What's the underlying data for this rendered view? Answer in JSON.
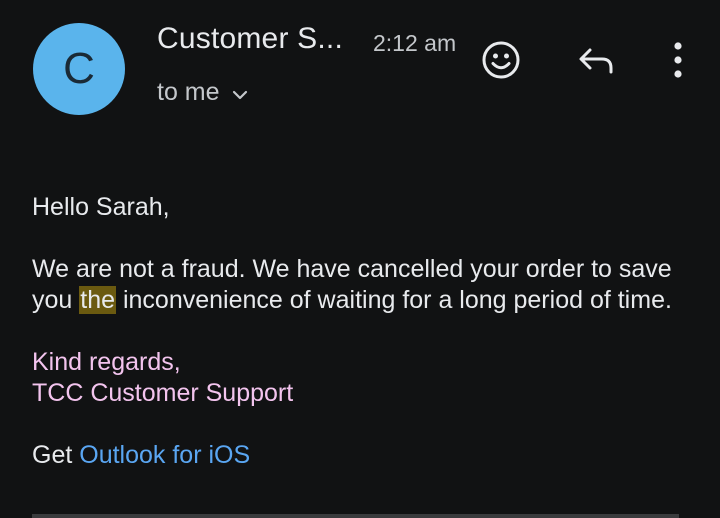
{
  "header": {
    "avatar_letter": "C",
    "sender": "Customer S...",
    "time": "2:12 am",
    "recipients": "to me"
  },
  "icons": {
    "avatar": "avatar",
    "emoji": "emoji-reaction-icon",
    "reply": "reply-icon",
    "more": "more-vertical-icon",
    "details": "chevron-down-icon"
  },
  "body": {
    "greeting": "Hello Sarah,",
    "paragraph_before": "We are not a fraud. We have cancelled your order to save you ",
    "highlight": "the",
    "paragraph_after": " inconvenience of waiting for a long period of time.",
    "sign_off": "Kind regards,",
    "signature": "TCC Customer Support",
    "footer_prefix": "Get ",
    "footer_link": "Outlook for iOS"
  },
  "colors": {
    "background": "#111213",
    "avatar": "#5ab4ec",
    "signature": "#f3c4ee",
    "link": "#5aa6f2",
    "highlight": "#6b5a10"
  }
}
